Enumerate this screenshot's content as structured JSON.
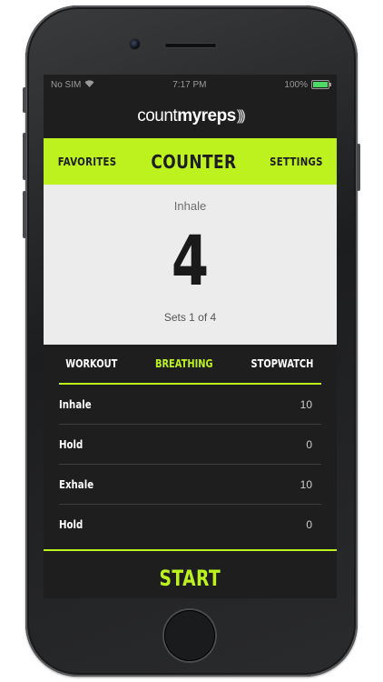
{
  "status": {
    "carrier": "No SIM",
    "time": "7:17 PM",
    "battery": "100%"
  },
  "brand": {
    "part1": "count",
    "part2": "myreps",
    "waves": ")))"
  },
  "topnav": {
    "left": "FAVORITES",
    "title": "COUNTER",
    "right": "SETTINGS"
  },
  "counter": {
    "phase": "Inhale",
    "count": "4",
    "sets": "Sets 1 of 4"
  },
  "tabs": [
    {
      "label": "WORKOUT",
      "active": false
    },
    {
      "label": "BREATHING",
      "active": true
    },
    {
      "label": "STOPWATCH",
      "active": false
    }
  ],
  "rows": [
    {
      "label": "Inhale",
      "value": "10"
    },
    {
      "label": "Hold",
      "value": "0"
    },
    {
      "label": "Exhale",
      "value": "10"
    },
    {
      "label": "Hold",
      "value": "0"
    }
  ],
  "start_label": "START",
  "colors": {
    "accent": "#bdf21f",
    "background": "#1e1e1e",
    "panel": "#ececec"
  }
}
